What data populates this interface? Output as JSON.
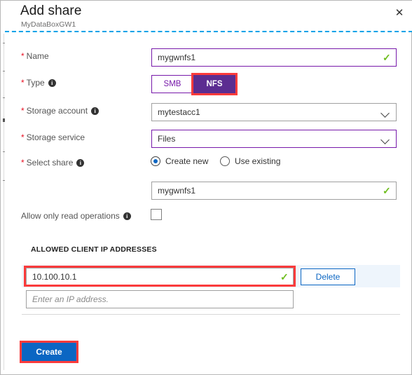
{
  "header": {
    "title": "Add share",
    "subtitle": "MyDataBoxGW1",
    "close_label": "✕"
  },
  "form": {
    "name": {
      "label": "Name",
      "required": true,
      "value": "mygwnfs1",
      "valid_mark": "✓"
    },
    "type": {
      "label": "Type",
      "required": true,
      "has_info": true,
      "options": [
        "SMB",
        "NFS"
      ],
      "selected": "NFS"
    },
    "storage_account": {
      "label": "Storage account",
      "required": true,
      "has_info": true,
      "value": "mytestacc1"
    },
    "storage_service": {
      "label": "Storage service",
      "required": true,
      "has_info": false,
      "value": "Files"
    },
    "select_share": {
      "label": "Select share",
      "required": true,
      "has_info": true,
      "radio_options": [
        {
          "label": "Create new",
          "selected": true
        },
        {
          "label": "Use existing",
          "selected": false
        }
      ],
      "share_name_value": "mygwnfs1",
      "valid_mark": "✓"
    },
    "read_only": {
      "label": "Allow only read operations",
      "has_info": true,
      "checked": false
    }
  },
  "ip_section": {
    "heading": "ALLOWED CLIENT IP ADDRESSES",
    "rows": [
      {
        "value": "10.100.10.1",
        "valid_mark": "✓",
        "delete_label": "Delete",
        "highlighted": true
      }
    ],
    "new_row_placeholder": "Enter an IP address."
  },
  "footer": {
    "create_label": "Create"
  },
  "colors": {
    "accent_purple": "#5c2d91",
    "field_purple": "#7719aa",
    "azure_blue": "#0b66c3",
    "highlight_red": "#fb3b3b",
    "valid_green": "#6fbe1f",
    "dash_cyan": "#00a2e8",
    "row_blue": "#eef5fc"
  }
}
